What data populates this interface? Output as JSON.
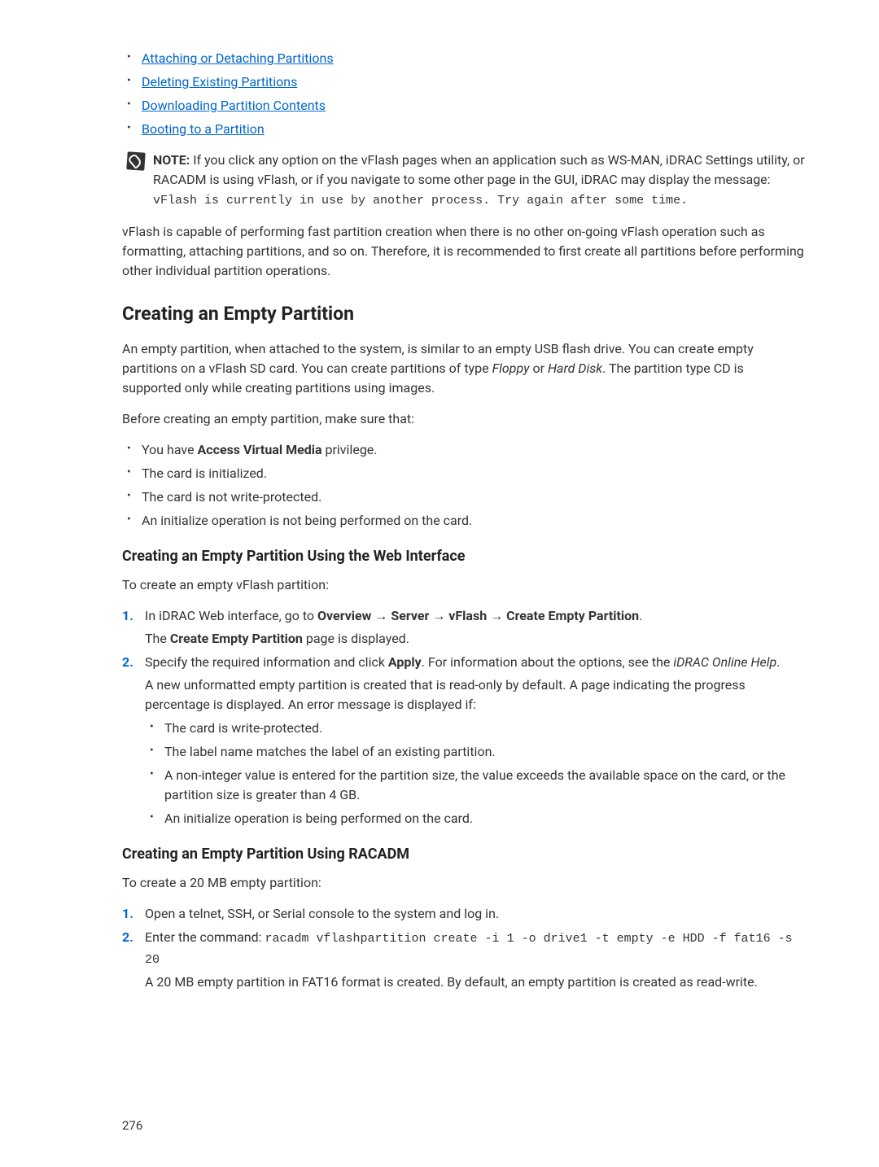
{
  "top_links": [
    "Attaching or Detaching Partitions",
    "Deleting Existing Partitions",
    "Downloading Partition Contents",
    "Booting to a Partition"
  ],
  "note": {
    "label": "NOTE:",
    "text_part1": " If you click any option on the vFlash pages when an application such as WS-MAN, iDRAC Settings utility, or RACADM is using vFlash, or if you navigate to some other page in the GUI, iDRAC may display the message: ",
    "mono": "vFlash is currently in use by another process. Try again after some time."
  },
  "para1": "vFlash is capable of performing fast partition creation when there is no other on-going vFlash operation such as formatting, attaching partitions, and so on. Therefore, it is recommended to first create all partitions before performing other individual partition operations.",
  "h2": "Creating an Empty Partition",
  "para2_part1": "An empty partition, when attached to the system, is similar to an empty USB flash drive. You can create empty partitions on a vFlash SD card. You can create partitions of type ",
  "para2_italic1": "Floppy",
  "para2_part2": " or ",
  "para2_italic2": "Hard Disk",
  "para2_part3": ". The partition type CD is supported only while creating partitions using images.",
  "para3": "Before creating an empty partition, make sure that:",
  "prereq": [
    {
      "pre": "You have ",
      "bold": "Access Virtual Media",
      "post": " privilege."
    },
    {
      "text": "The card is initialized."
    },
    {
      "text": "The card is not write-protected."
    },
    {
      "text": "An initialize operation is not being performed on the card."
    }
  ],
  "h3_web": "Creating an Empty Partition Using the Web Interface",
  "para_web_intro": "To create an empty vFlash partition:",
  "web_steps": {
    "step1": {
      "pre": "In iDRAC Web interface, go to ",
      "b1": "Overview",
      "arrow": " → ",
      "b2": "Server",
      "b3": "vFlash",
      "b4": "Create Empty Partition",
      "body_pre": "The ",
      "body_bold": "Create Empty Partition",
      "body_post": " page is displayed."
    },
    "step2": {
      "pre": "Specify the required information and click ",
      "bold": "Apply",
      "post": ". For information about the options, see the ",
      "italic": "iDRAC Online Help",
      "body1": "A new unformatted empty partition is created that is read-only by default. A page indicating the progress percentage is displayed. An error message is displayed if:",
      "bullets": [
        "The card is write-protected.",
        "The label name matches the label of an existing partition.",
        "A non-integer value is entered for the partition size, the value exceeds the available space on the card, or the partition size is greater than 4 GB.",
        "An initialize operation is being performed on the card."
      ]
    }
  },
  "h3_racadm": "Creating an Empty Partition Using RACADM",
  "para_racadm_intro": "To create a 20 MB empty partition:",
  "racadm_steps": {
    "step1": "Open a telnet, SSH, or Serial console to the system and log in.",
    "step2_pre": "Enter the command: ",
    "step2_mono": "racadm vflashpartition create -i 1 -o drive1 -t empty -e HDD -f fat16 -s 20",
    "step2_body": "A 20 MB empty partition in FAT16 format is created. By default, an empty partition is created as read-write."
  },
  "page_number": "276"
}
